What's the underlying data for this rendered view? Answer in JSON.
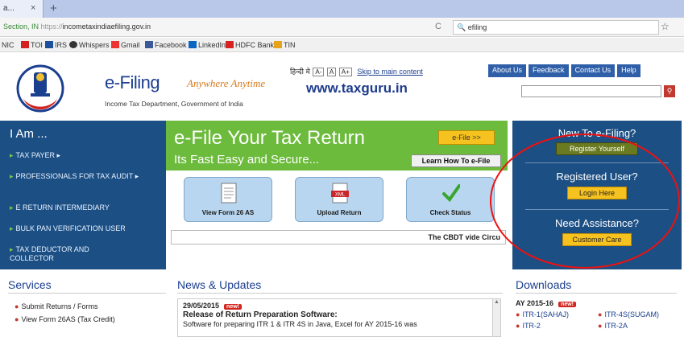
{
  "browser": {
    "tab_label": "a...",
    "tab_close": "×",
    "new_tab": "+",
    "url_secure": "Section, IN",
    "url_proto": "https://",
    "url_host": "incometaxindiaefiling.gov.in",
    "reload": "C",
    "search_value": "efiling",
    "bookmarks": [
      "NIC",
      "TOI",
      "IRS",
      "Whispers",
      "Gmail",
      "Facebook",
      "LinkedIn",
      "HDFC Bank",
      "TIN"
    ]
  },
  "header": {
    "title": "e-Filing",
    "tagline": "Anywhere Anytime",
    "department": "Income Tax Department, Government of India",
    "hindi": "हिन्दी मे",
    "font_sizes": [
      "A-",
      "A",
      "A+"
    ],
    "skip": "Skip to main content",
    "watermark": "www.taxguru.in",
    "nav": [
      "About Us",
      "Feedback",
      "Contact Us",
      "Help"
    ]
  },
  "iam": {
    "title": "I Am ...",
    "items": [
      "TAX PAYER ▸",
      "PROFESSIONALS FOR TAX AUDIT ▸",
      "E RETURN INTERMEDIARY",
      "BULK PAN VERIFICATION USER",
      "TAX DEDUCTOR AND COLLECTOR"
    ]
  },
  "banner": {
    "title": "e-File Your Tax Return",
    "subtitle": "Its Fast Easy and Secure...",
    "efile_btn": "e-File >>",
    "learn_btn": "Learn How To e-File"
  },
  "tiles": [
    "View Form 26 AS",
    "Upload Return",
    "Check Status"
  ],
  "cbdt_ticker": "The CBDT vide Circu",
  "right_panel": {
    "new_heading": "New To e-Filing?",
    "register": "Register Yourself",
    "registered_heading": "Registered User?",
    "login": "Login Here",
    "assist_heading": "Need Assistance?",
    "care": "Customer Care"
  },
  "services": {
    "heading": "Services",
    "items": [
      "Submit Returns / Forms",
      "View Form 26AS (Tax Credit)"
    ]
  },
  "news": {
    "heading": "News & Updates",
    "date": "29/05/2015",
    "badge": "new!",
    "headline": "Release of Return Preparation Software:",
    "text": "Software for preparing ITR 1 & ITR 4S in Java, Excel for AY 2015-16 was"
  },
  "downloads": {
    "heading": "Downloads",
    "ay": "AY 2015-16",
    "badge": "new!",
    "items": [
      "ITR-1(SAHAJ)",
      "ITR-4S(SUGAM)",
      "ITR-2",
      "ITR-2A"
    ]
  }
}
